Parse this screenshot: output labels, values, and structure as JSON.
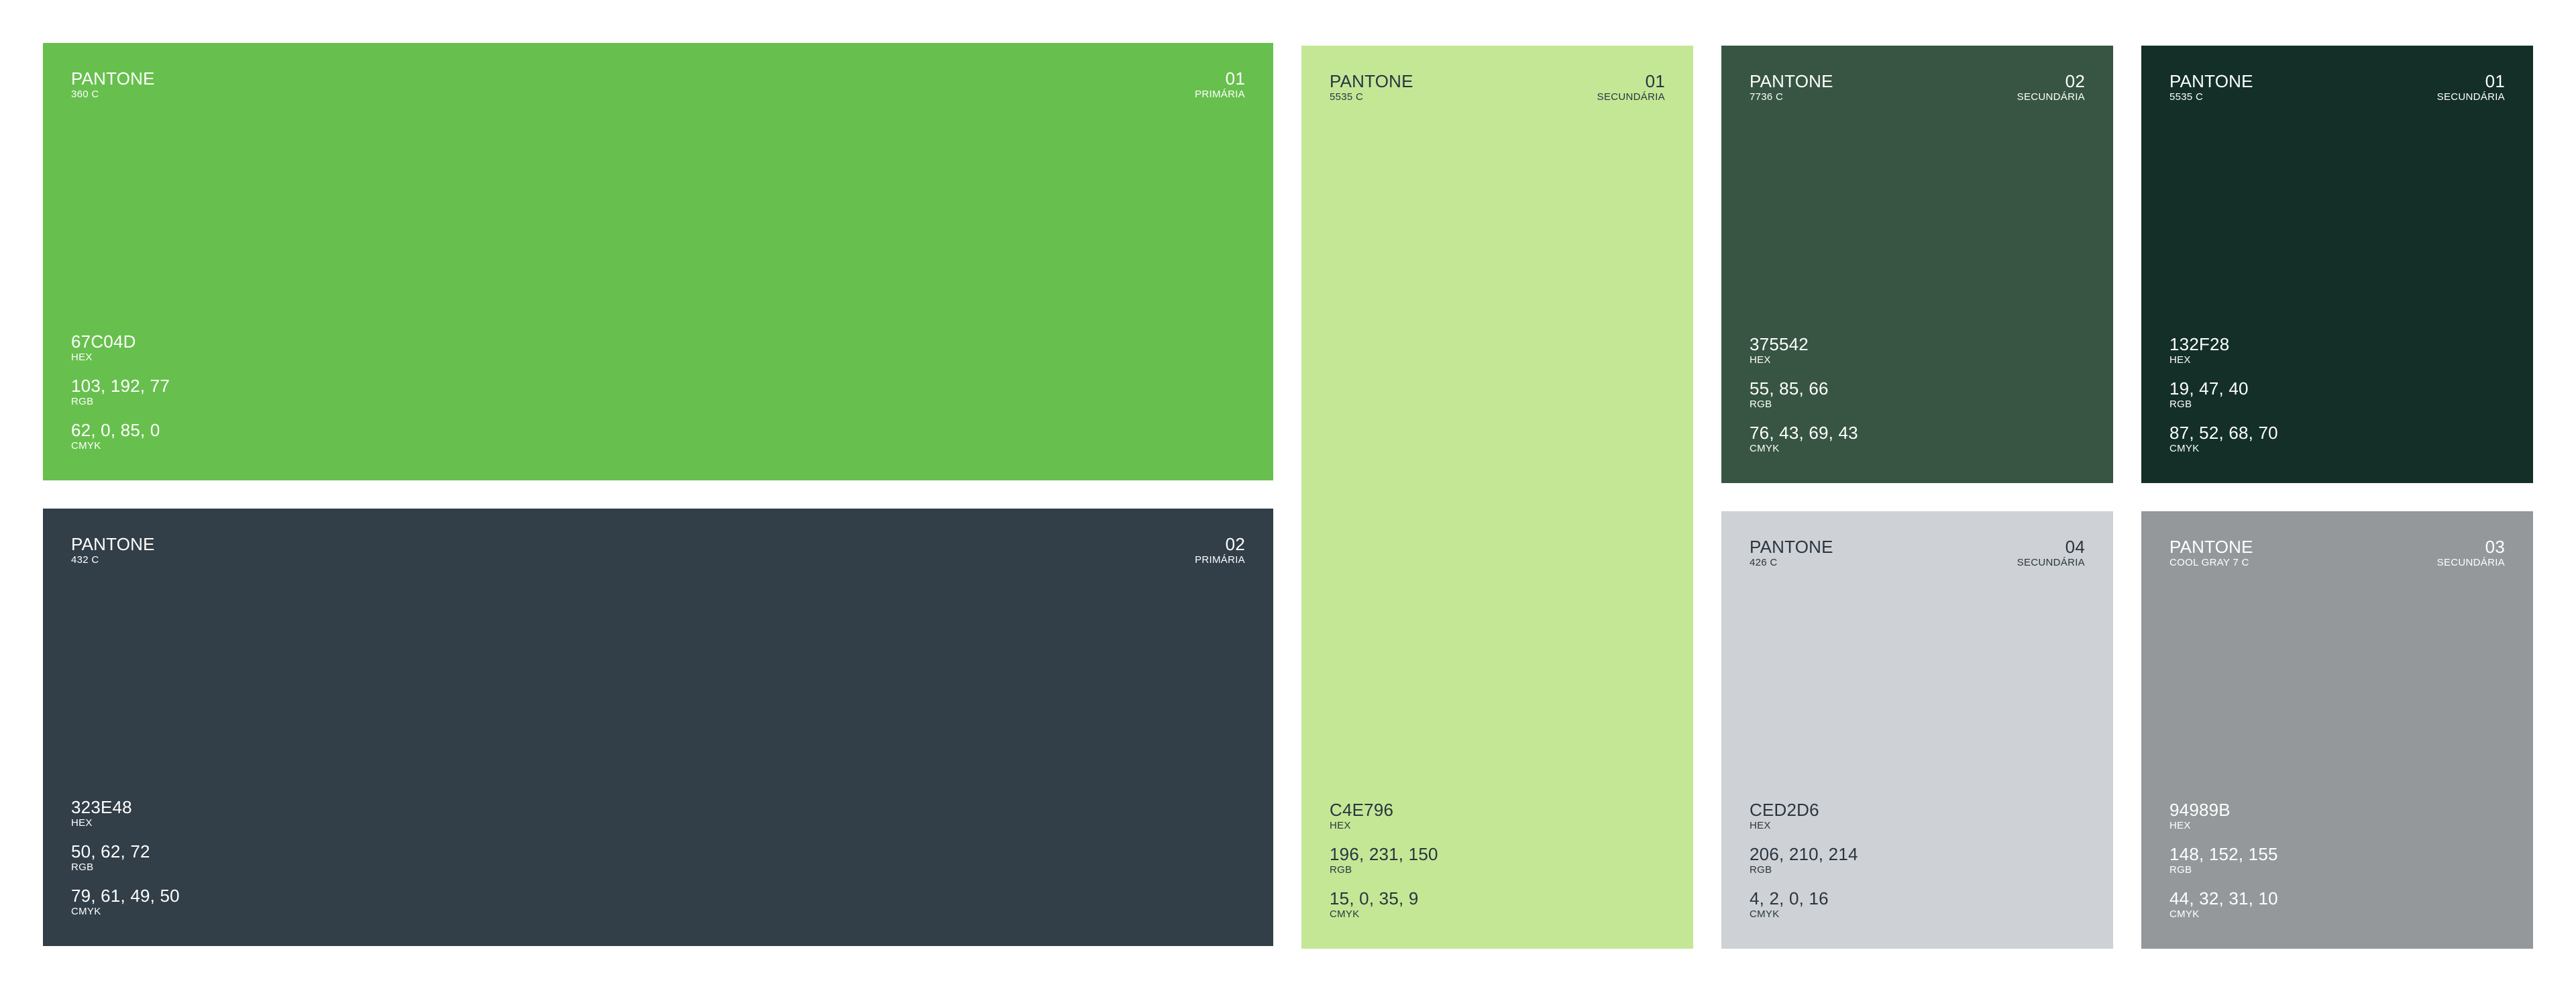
{
  "swatches": [
    {
      "id": "pantone-360c",
      "label": "PANTONE",
      "code": "360 C",
      "number": "01",
      "role": "PRIMÁRIA",
      "color": "#67C04D",
      "hex": "67C04D",
      "hex_label": "HEX",
      "rgb": "103, 192, 77",
      "rgb_label": "RGB",
      "cmyk": "62, 0, 85, 0",
      "cmyk_label": "CMYK"
    },
    {
      "id": "pantone-432c",
      "label": "PANTONE",
      "code": "432 C",
      "number": "02",
      "role": "PRIMÁRIA",
      "color": "#323E48",
      "hex": "323E48",
      "hex_label": "HEX",
      "rgb": "50, 62, 72",
      "rgb_label": "RGB",
      "cmyk": "79, 61, 49, 50",
      "cmyk_label": "CMYK"
    },
    {
      "id": "pantone-5535c-light",
      "label": "PANTONE",
      "code": "5535 C",
      "number": "01",
      "role": "SECUNDÁRIA",
      "color": "#C4E796",
      "hex": "C4E796",
      "hex_label": "HEX",
      "rgb": "196, 231, 150",
      "rgb_label": "RGB",
      "cmyk": "15, 0, 35, 9",
      "cmyk_label": "CMYK"
    },
    {
      "id": "pantone-7736c",
      "label": "PANTONE",
      "code": "7736 C",
      "number": "02",
      "role": "SECUNDÁRIA",
      "color": "#375542",
      "hex": "375542",
      "hex_label": "HEX",
      "rgb": "55, 85, 66",
      "rgb_label": "RGB",
      "cmyk": "76, 43, 69, 43",
      "cmyk_label": "CMYK"
    },
    {
      "id": "pantone-5535c-dark",
      "label": "PANTONE",
      "code": "5535 C",
      "number": "01",
      "role": "SECUNDÁRIA",
      "color": "#132F28",
      "hex": "132F28",
      "hex_label": "HEX",
      "rgb": "19, 47, 40",
      "rgb_label": "RGB",
      "cmyk": "87, 52, 68, 70",
      "cmyk_label": "CMYK"
    },
    {
      "id": "pantone-426c",
      "label": "PANTONE",
      "code": "426 C",
      "number": "04",
      "role": "SECUNDÁRIA",
      "color": "#CED2D6",
      "hex": "CED2D6",
      "hex_label": "HEX",
      "rgb": "206, 210, 214",
      "rgb_label": "RGB",
      "cmyk": "4, 2, 0, 16",
      "cmyk_label": "CMYK"
    },
    {
      "id": "pantone-coolgray7c",
      "label": "PANTONE",
      "code": "COOL GRAY 7 C",
      "number": "03",
      "role": "SECUNDÁRIA",
      "color": "#94989B",
      "hex": "94989B",
      "hex_label": "HEX",
      "rgb": "148, 152, 155",
      "rgb_label": "RGB",
      "cmyk": "44, 32, 31, 10",
      "cmyk_label": "CMYK"
    }
  ]
}
